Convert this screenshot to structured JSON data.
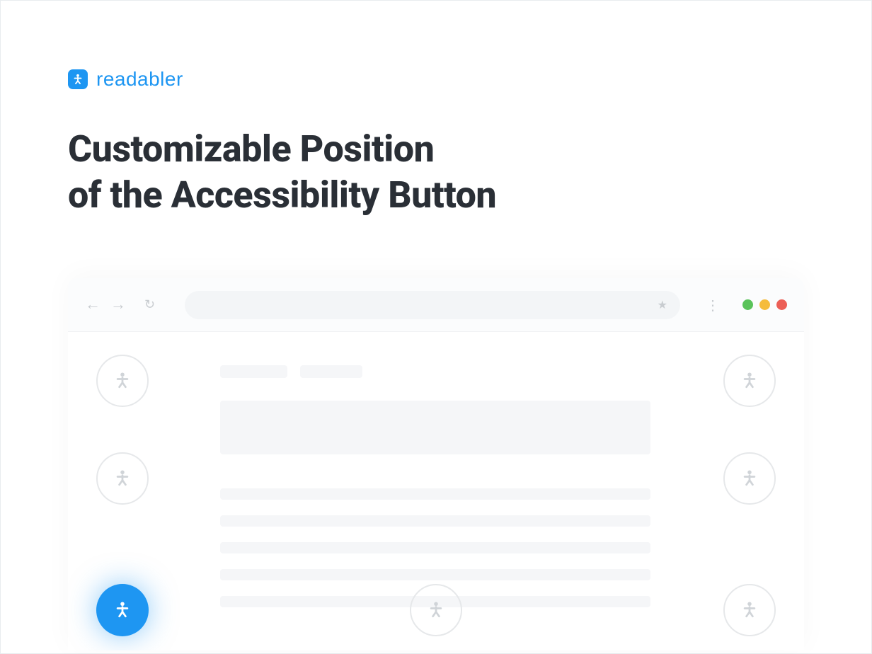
{
  "brand": {
    "name": "readabler"
  },
  "heading": {
    "line1": "Customizable Position",
    "line2": "of the Accessibility Button"
  },
  "colors": {
    "accent": "#1e96f2",
    "text": "#2a2f36"
  }
}
